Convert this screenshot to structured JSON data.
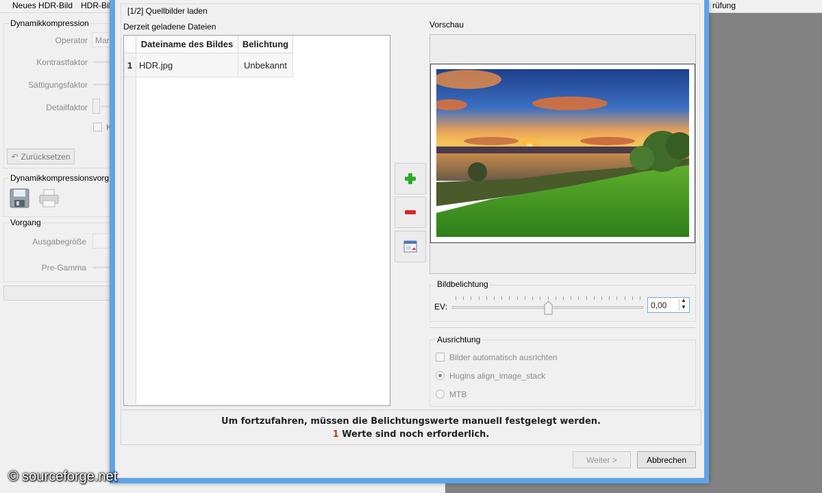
{
  "menu": {
    "item1": "Neues HDR-Bild",
    "item2": "HDR-Bil",
    "right_fragment": "rüfung"
  },
  "left_panel": {
    "dyn_group_title": "Dynamikkompression",
    "operator_label": "Operator",
    "operator_value": "Mar",
    "contrast_label": "Kontrastfaktor",
    "saturation_label": "Sättigungsfaktor",
    "detail_label": "Detailfaktor",
    "checkbox_fragment": "K",
    "reset_button": "Zurücksetzen",
    "presets_title": "Dynamikkompressionsvorg",
    "process_title": "Vorgang",
    "output_size_label": "Ausgabegröße",
    "pregamma_label": "Pre-Gamma"
  },
  "dialog": {
    "title": "[1/2] Quellbilder laden",
    "loaded_files_label": "Derzeit geladene Dateien",
    "table": {
      "headers": [
        "Dateiname des Bildes",
        "Belichtung"
      ],
      "rows": [
        {
          "index": "1",
          "filename": "HDR.jpg",
          "exposure": "Unbekannt"
        }
      ]
    },
    "preview_label": "Vorschau",
    "exposure_group": {
      "title": "Bildbelichtung",
      "ev_label": "EV:",
      "ev_value": "0,00",
      "slider_position": 0.5
    },
    "alignment_group": {
      "title": "Ausrichtung",
      "auto_align": "Bilder automatisch ausrichten",
      "option_hugin": "Hugins align_image_stack",
      "option_mtb": "MTB"
    },
    "message_line1": "Um fortzufahren, müssen die Belichtungswerte manuell festgelegt werden.",
    "message_count": "1",
    "message_line2": "Werte sind noch erforderlich.",
    "next_button": "Weiter >",
    "cancel_button": "Abbrechen"
  },
  "watermark": "© sourceforge.net",
  "colors": {
    "accent_frame": "#5fa4e8",
    "add_icon": "#2fa82f",
    "remove_icon": "#d42a2a",
    "count_red": "#c0392b"
  },
  "icons": [
    "plus-icon",
    "minus-icon",
    "image-window-icon",
    "save-icon",
    "print-icon",
    "reset-arrow-icon"
  ]
}
